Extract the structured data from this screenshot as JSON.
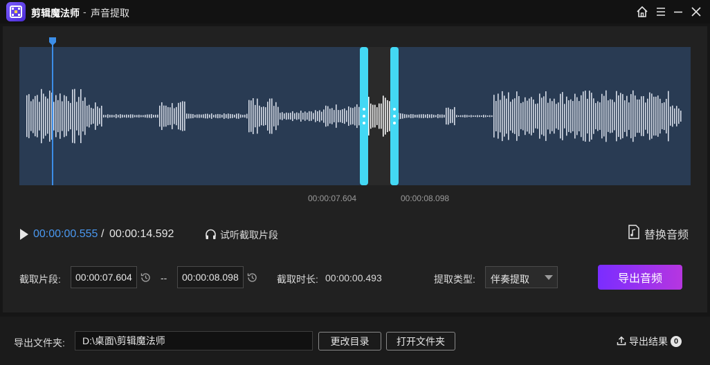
{
  "titlebar": {
    "app_name": "剪辑魔法师",
    "separator": "-",
    "module_name": "声音提取",
    "icons": [
      "home-icon",
      "menu-icon",
      "minimize-icon",
      "close-icon"
    ]
  },
  "waveform": {
    "selection_start_label": "00:00:07.604",
    "selection_end_label": "00:00:08.098",
    "playhead_fraction": 0.038,
    "selection_start_fraction": 0.521,
    "selection_end_fraction": 0.555,
    "colors": {
      "background": "#293b53",
      "bars": "#d7dde8",
      "selection_handle": "#43d8f4",
      "playhead": "#3c8ee8"
    }
  },
  "playback": {
    "current_time": "00:00:00.555",
    "separator": "/",
    "total_time": "00:00:14.592",
    "preview_label": "试听截取片段",
    "replace_label": "替换音频"
  },
  "clip": {
    "label": "截取片段:",
    "start_value": "00:00:07.604",
    "dash": "--",
    "end_value": "00:00:08.098",
    "duration_label": "截取时长:",
    "duration_value": "00:00:00.493",
    "type_label": "提取类型:",
    "type_selected": "伴奏提取",
    "export_button": "导出音频"
  },
  "output": {
    "folder_label": "导出文件夹:",
    "folder_path": "D:\\桌面\\剪辑魔法师",
    "change_dir_button": "更改目录",
    "open_folder_button": "打开文件夹",
    "export_results_label": "导出结果",
    "export_results_count": "0"
  },
  "colors": {
    "accent_blue": "#4a98f0",
    "export_gradient_start": "#7a2dff",
    "export_gradient_end": "#b636e0"
  }
}
